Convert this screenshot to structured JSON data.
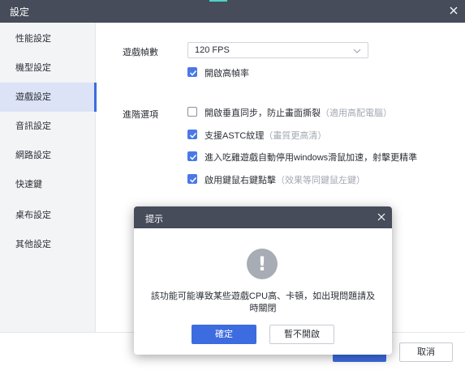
{
  "window": {
    "title": "設定"
  },
  "sidebar": {
    "items": [
      {
        "label": "性能設定",
        "active": false
      },
      {
        "label": "機型設定",
        "active": false
      },
      {
        "label": "遊戲設定",
        "active": true
      },
      {
        "label": "音訊設定",
        "active": false
      },
      {
        "label": "網路設定",
        "active": false
      },
      {
        "label": "快速鍵",
        "active": false
      },
      {
        "label": "桌布設定",
        "active": false
      },
      {
        "label": "其他設定",
        "active": false
      }
    ]
  },
  "game": {
    "fps_label": "遊戲幀數",
    "fps_value": "120 FPS",
    "high_fps": {
      "label": "開啟高幀率",
      "checked": true
    },
    "advanced_label": "進階選項",
    "options": [
      {
        "label": "開啟垂直同步，防止畫面撕裂",
        "hint": "（適用高配電腦）",
        "checked": false
      },
      {
        "label": "支援ASTC紋理",
        "hint": "（畫質更高清）",
        "checked": true
      },
      {
        "label": "進入吃雞遊戲自動停用windows滑鼠加速，射擊更精準",
        "hint": "",
        "checked": true
      },
      {
        "label": "啟用鍵鼠右鍵點擊",
        "hint": "（效果等同鍵鼠左鍵）",
        "checked": true
      }
    ]
  },
  "footer": {
    "cancel_label": "取消"
  },
  "modal": {
    "title": "提示",
    "icon": "exclamation-icon",
    "message": "該功能可能導致某些遊戲CPU高、卡頓，如出現問題請及時關閉",
    "confirm_label": "確定",
    "decline_label": "暫不開啟"
  },
  "colors": {
    "titlebar": "#464c5a",
    "accent": "#3d6be0",
    "active_nav_bg": "#dde3f6"
  }
}
